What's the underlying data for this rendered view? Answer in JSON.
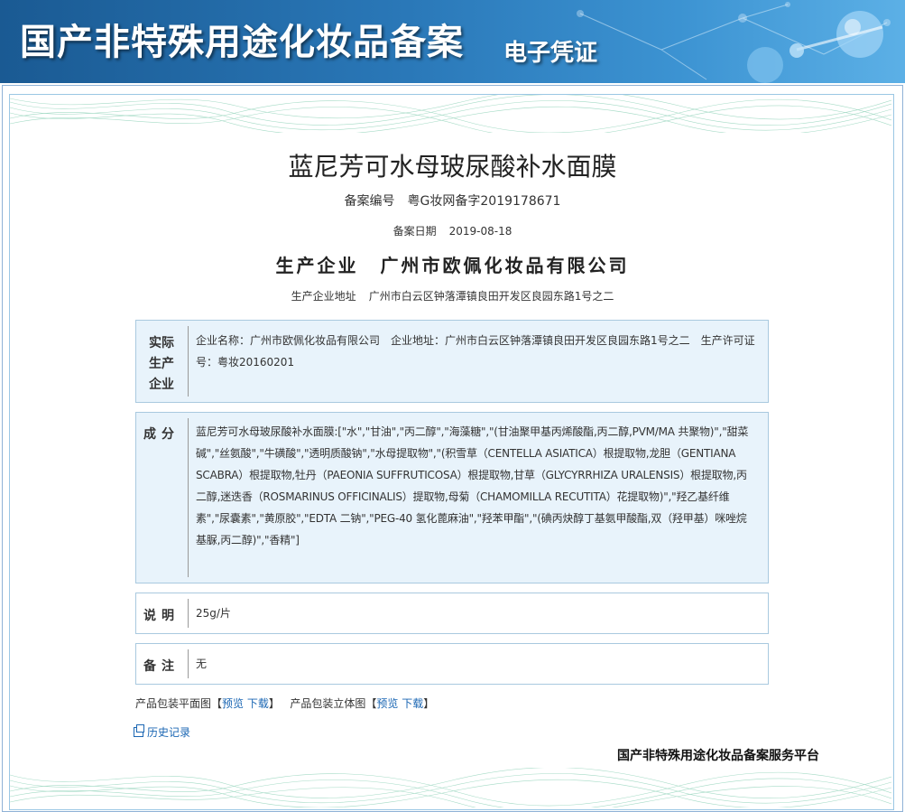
{
  "banner": {
    "title": "国产非特殊用途化妆品备案",
    "subtitle": "电子凭证"
  },
  "document": {
    "product_name": "蓝尼芳可水母玻尿酸补水面膜",
    "registration_label": "备案编号",
    "registration_number": "粤G妆网备字2019178671",
    "date_label": "备案日期",
    "date_value": "2019-08-18",
    "manufacturer_label": "生产企业",
    "manufacturer_name": "广州市欧佩化妆品有限公司",
    "address_label": "生产企业地址",
    "address_value": "广州市白云区钟落潭镇良田开发区良园东路1号之二"
  },
  "sections": {
    "actual": {
      "label_line1": "实际",
      "label_line2": "生产",
      "label_line3": "企业",
      "text": "企业名称：广州市欧佩化妆品有限公司　企业地址：广州市白云区钟落潭镇良田开发区良园东路1号之二　生产许可证号：粤妆20160201"
    },
    "ingredients": {
      "label": "成分",
      "text": "蓝尼芳可水母玻尿酸补水面膜:[\"水\",\"甘油\",\"丙二醇\",\"海藻糖\",\"(甘油聚甲基丙烯酸酯,丙二醇,PVM/MA 共聚物)\",\"甜菜碱\",\"丝氨酸\",\"牛磺酸\",\"透明质酸钠\",\"水母提取物\",\"(积雪草（CENTELLA ASIATICA）根提取物,龙胆（GENTIANA SCABRA）根提取物,牡丹（PAEONIA SUFFRUTICOSA）根提取物,甘草（GLYCYRRHIZA URALENSIS）根提取物,丙二醇,迷迭香（ROSMARINUS OFFICINALIS）提取物,母菊（CHAMOMILLA RECUTITA）花提取物)\",\"羟乙基纤维素\",\"尿囊素\",\"黄原胶\",\"EDTA 二钠\",\"PEG-40 氢化蓖麻油\",\"羟苯甲酯\",\"(碘丙炔醇丁基氨甲酸酯,双（羟甲基）咪唑烷基脲,丙二醇)\",\"香精\"]"
    },
    "description": {
      "label": "说明",
      "text": "25g/片"
    },
    "remarks": {
      "label": "备注",
      "text": "无"
    }
  },
  "links": {
    "flat_label": "产品包装平面图",
    "stereo_label": "产品包装立体图",
    "bracket_open": "【",
    "bracket_close": "】",
    "preview": "预览",
    "download": "下载",
    "history": "历史记录"
  },
  "footer": {
    "brand": "国产非特殊用途化妆品备案服务平台"
  },
  "colors": {
    "banner": "#2a78b8",
    "panel_blue": "#e8f3fb",
    "panel_border": "#a9c9df",
    "link": "#1a66b3"
  }
}
